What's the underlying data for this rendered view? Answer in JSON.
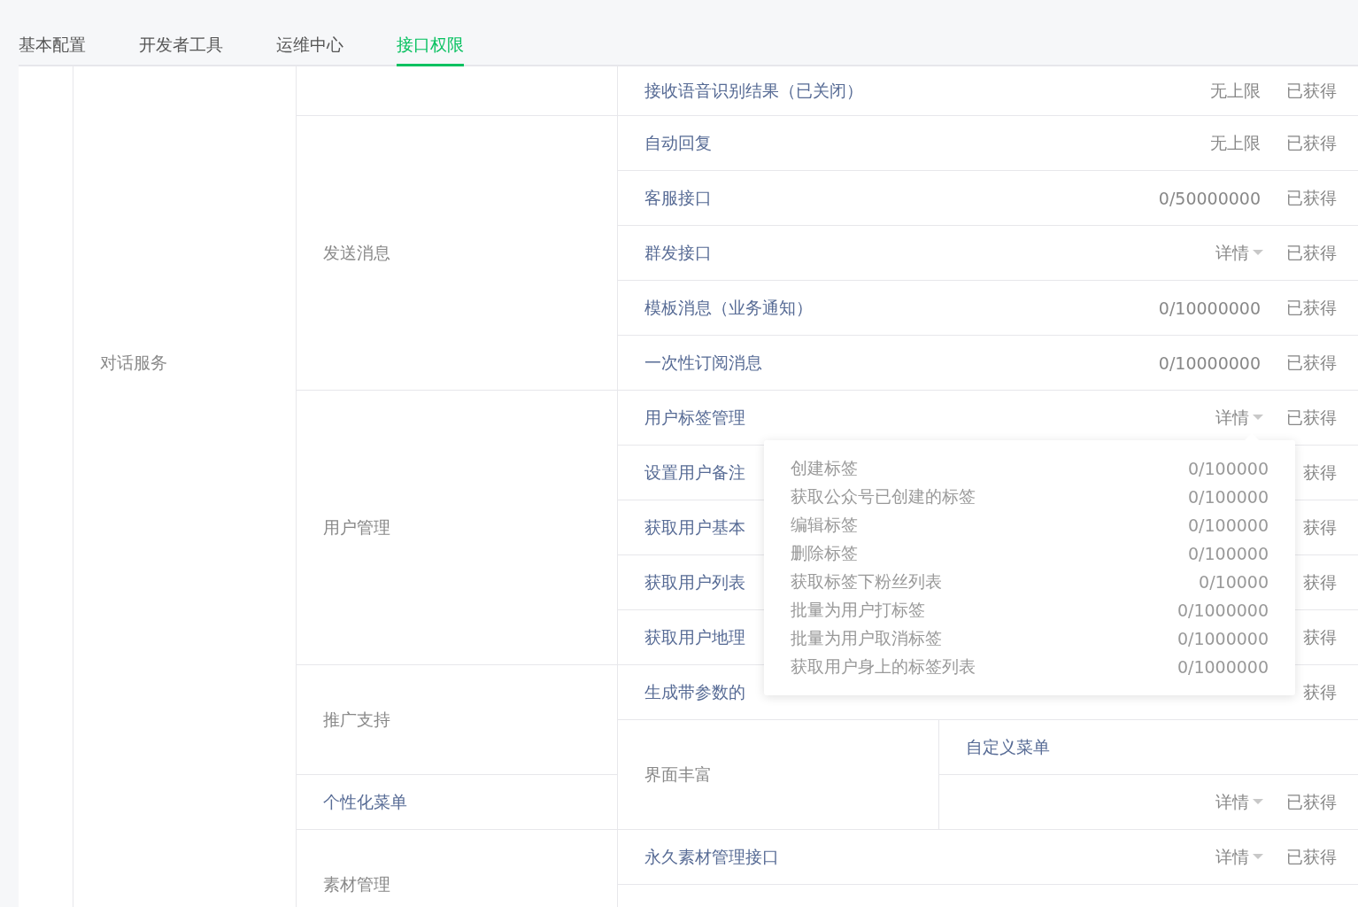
{
  "tabs": [
    {
      "label": "基本配置",
      "selected": false
    },
    {
      "label": "开发者工具",
      "selected": false
    },
    {
      "label": "运维中心",
      "selected": false
    },
    {
      "label": "接口权限",
      "selected": true
    }
  ],
  "table": {
    "category": "对话服务",
    "groups": [
      {
        "kind": "empty"
      },
      {
        "label": "发送消息",
        "kind": "text"
      },
      {
        "label": "用户管理",
        "kind": "text"
      },
      {
        "label": "推广支持",
        "kind": "text"
      },
      {
        "label": "个性化菜单",
        "kind": "link"
      },
      {
        "label": "素材管理",
        "kind": "text"
      }
    ],
    "rows": [
      {
        "kind": "api",
        "name": "接收语音识别结果（已关闭）",
        "quota": "无上限",
        "status": "已获得"
      },
      {
        "kind": "api",
        "name": "自动回复",
        "quota": "无上限",
        "status": "已获得"
      },
      {
        "kind": "api",
        "name": "客服接口",
        "quota": "0/50000000",
        "status": "已获得"
      },
      {
        "kind": "api",
        "name": "群发接口",
        "detail": {
          "label": "详情"
        },
        "status": "已获得"
      },
      {
        "kind": "api",
        "name": "模板消息（业务通知）",
        "quota": "0/10000000",
        "status": "已获得"
      },
      {
        "kind": "api",
        "name": "一次性订阅消息",
        "quota": "0/10000000",
        "status": "已获得"
      },
      {
        "kind": "api",
        "name": "用户标签管理",
        "detail": {
          "label": "详情",
          "items": [
            {
              "name": "创建标签",
              "quota": "0/100000"
            },
            {
              "name": "获取公众号已创建的标签",
              "quota": "0/100000"
            },
            {
              "name": "编辑标签",
              "quota": "0/100000"
            },
            {
              "name": "删除标签",
              "quota": "0/100000"
            },
            {
              "name": "获取标签下粉丝列表",
              "quota": "0/10000"
            },
            {
              "name": "批量为用户打标签",
              "quota": "0/1000000"
            },
            {
              "name": "批量为用户取消标签",
              "quota": "0/1000000"
            },
            {
              "name": "获取用户身上的标签列表",
              "quota": "0/1000000"
            }
          ]
        },
        "status": "已获得"
      },
      {
        "kind": "api",
        "name": "设置用户备注",
        "status": "获得"
      },
      {
        "kind": "api",
        "name": "获取用户基本",
        "status": "获得"
      },
      {
        "kind": "api",
        "name": "获取用户列表",
        "status": "获得"
      },
      {
        "kind": "api",
        "name": "获取用户地理",
        "status": "获得"
      },
      {
        "kind": "api",
        "name": "生成带参数的",
        "status": "获得"
      },
      {
        "kind": "section",
        "label": "界面丰富",
        "name": "自定义菜单",
        "detail": {
          "label": "详情"
        },
        "status": "已获得"
      },
      {
        "kind": "api",
        "name": "永久素材管理接口",
        "detail": {
          "label": "详情"
        },
        "status": "已获得"
      },
      {
        "kind": "empty"
      }
    ]
  }
}
